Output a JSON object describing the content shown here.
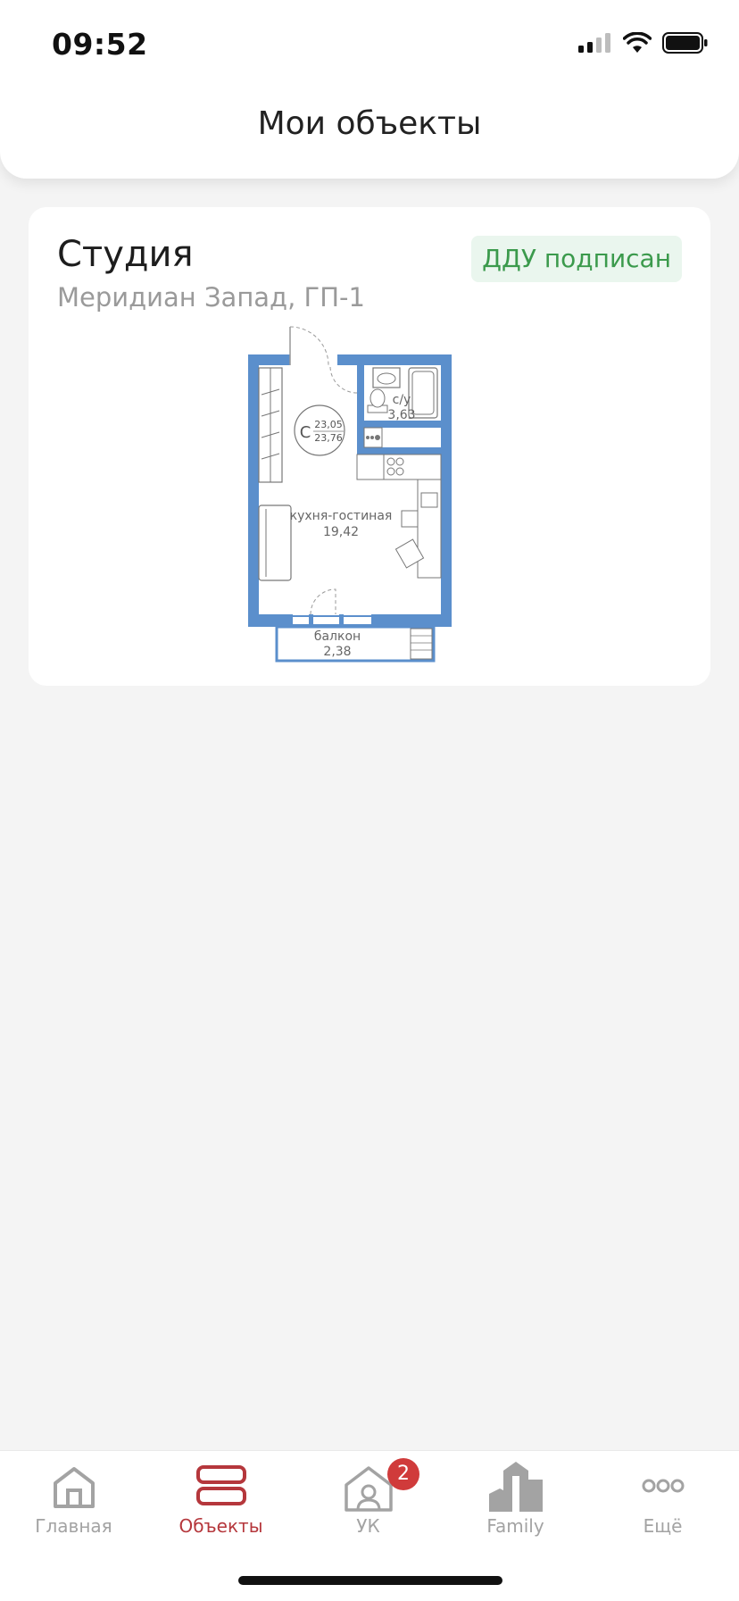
{
  "status_bar": {
    "time": "09:52"
  },
  "header": {
    "title": "Мои объекты"
  },
  "property": {
    "type": "Студия",
    "complex": "Меридиан Запад, ГП-1",
    "status": "ДДУ подписан",
    "plan": {
      "studio_mark": "С",
      "area_living": "23,05",
      "area_total": "23,76",
      "bathroom_label": "с/у",
      "bathroom_area": "3,63",
      "kitchen_label": "кухня-гостиная",
      "kitchen_area": "19,42",
      "balcony_label": "балкон",
      "balcony_area": "2,38"
    }
  },
  "tabbar": {
    "items": [
      {
        "label": "Главная",
        "icon": "home-icon"
      },
      {
        "label": "Объекты",
        "icon": "objects-icon"
      },
      {
        "label": "УК",
        "icon": "management-icon",
        "badge": "2"
      },
      {
        "label": "Family",
        "icon": "family-icon"
      },
      {
        "label": "Ещё",
        "icon": "more-icon"
      }
    ]
  },
  "colors": {
    "accent": "#b5373c",
    "status_green": "#3b9a4c",
    "plan_blue": "#5b8fcc"
  }
}
